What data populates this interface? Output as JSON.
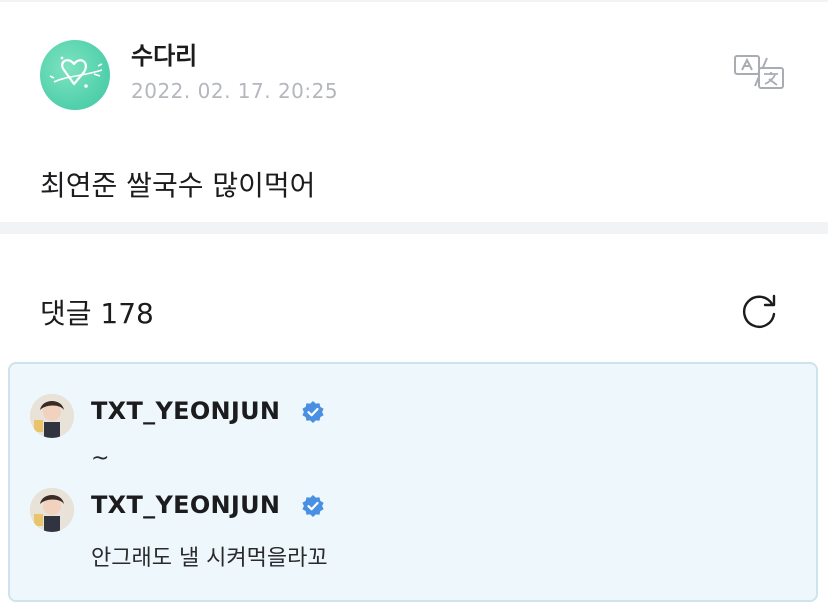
{
  "post": {
    "author": "수다리",
    "date": "2022. 02. 17. 20:25",
    "body": "최연준 쌀국수 많이먹어",
    "avatar_icon": "heart-doodle-icon",
    "avatar_color": "#4fcfaa",
    "translate_icon": "translate-icon"
  },
  "comments_section": {
    "title": "댓글 178",
    "refresh_icon": "refresh-icon"
  },
  "comments": [
    {
      "author": "TXT_YEONJUN",
      "verified": true,
      "text": "~"
    },
    {
      "author": "TXT_YEONJUN",
      "verified": true,
      "text": "안그래도 낼 시켜먹을라꼬"
    }
  ],
  "colors": {
    "accent_verified": "#4a90e2",
    "highlight_bg": "#eef7fc",
    "highlight_border": "#cfe3ee",
    "muted_text": "#b4b7bd"
  }
}
